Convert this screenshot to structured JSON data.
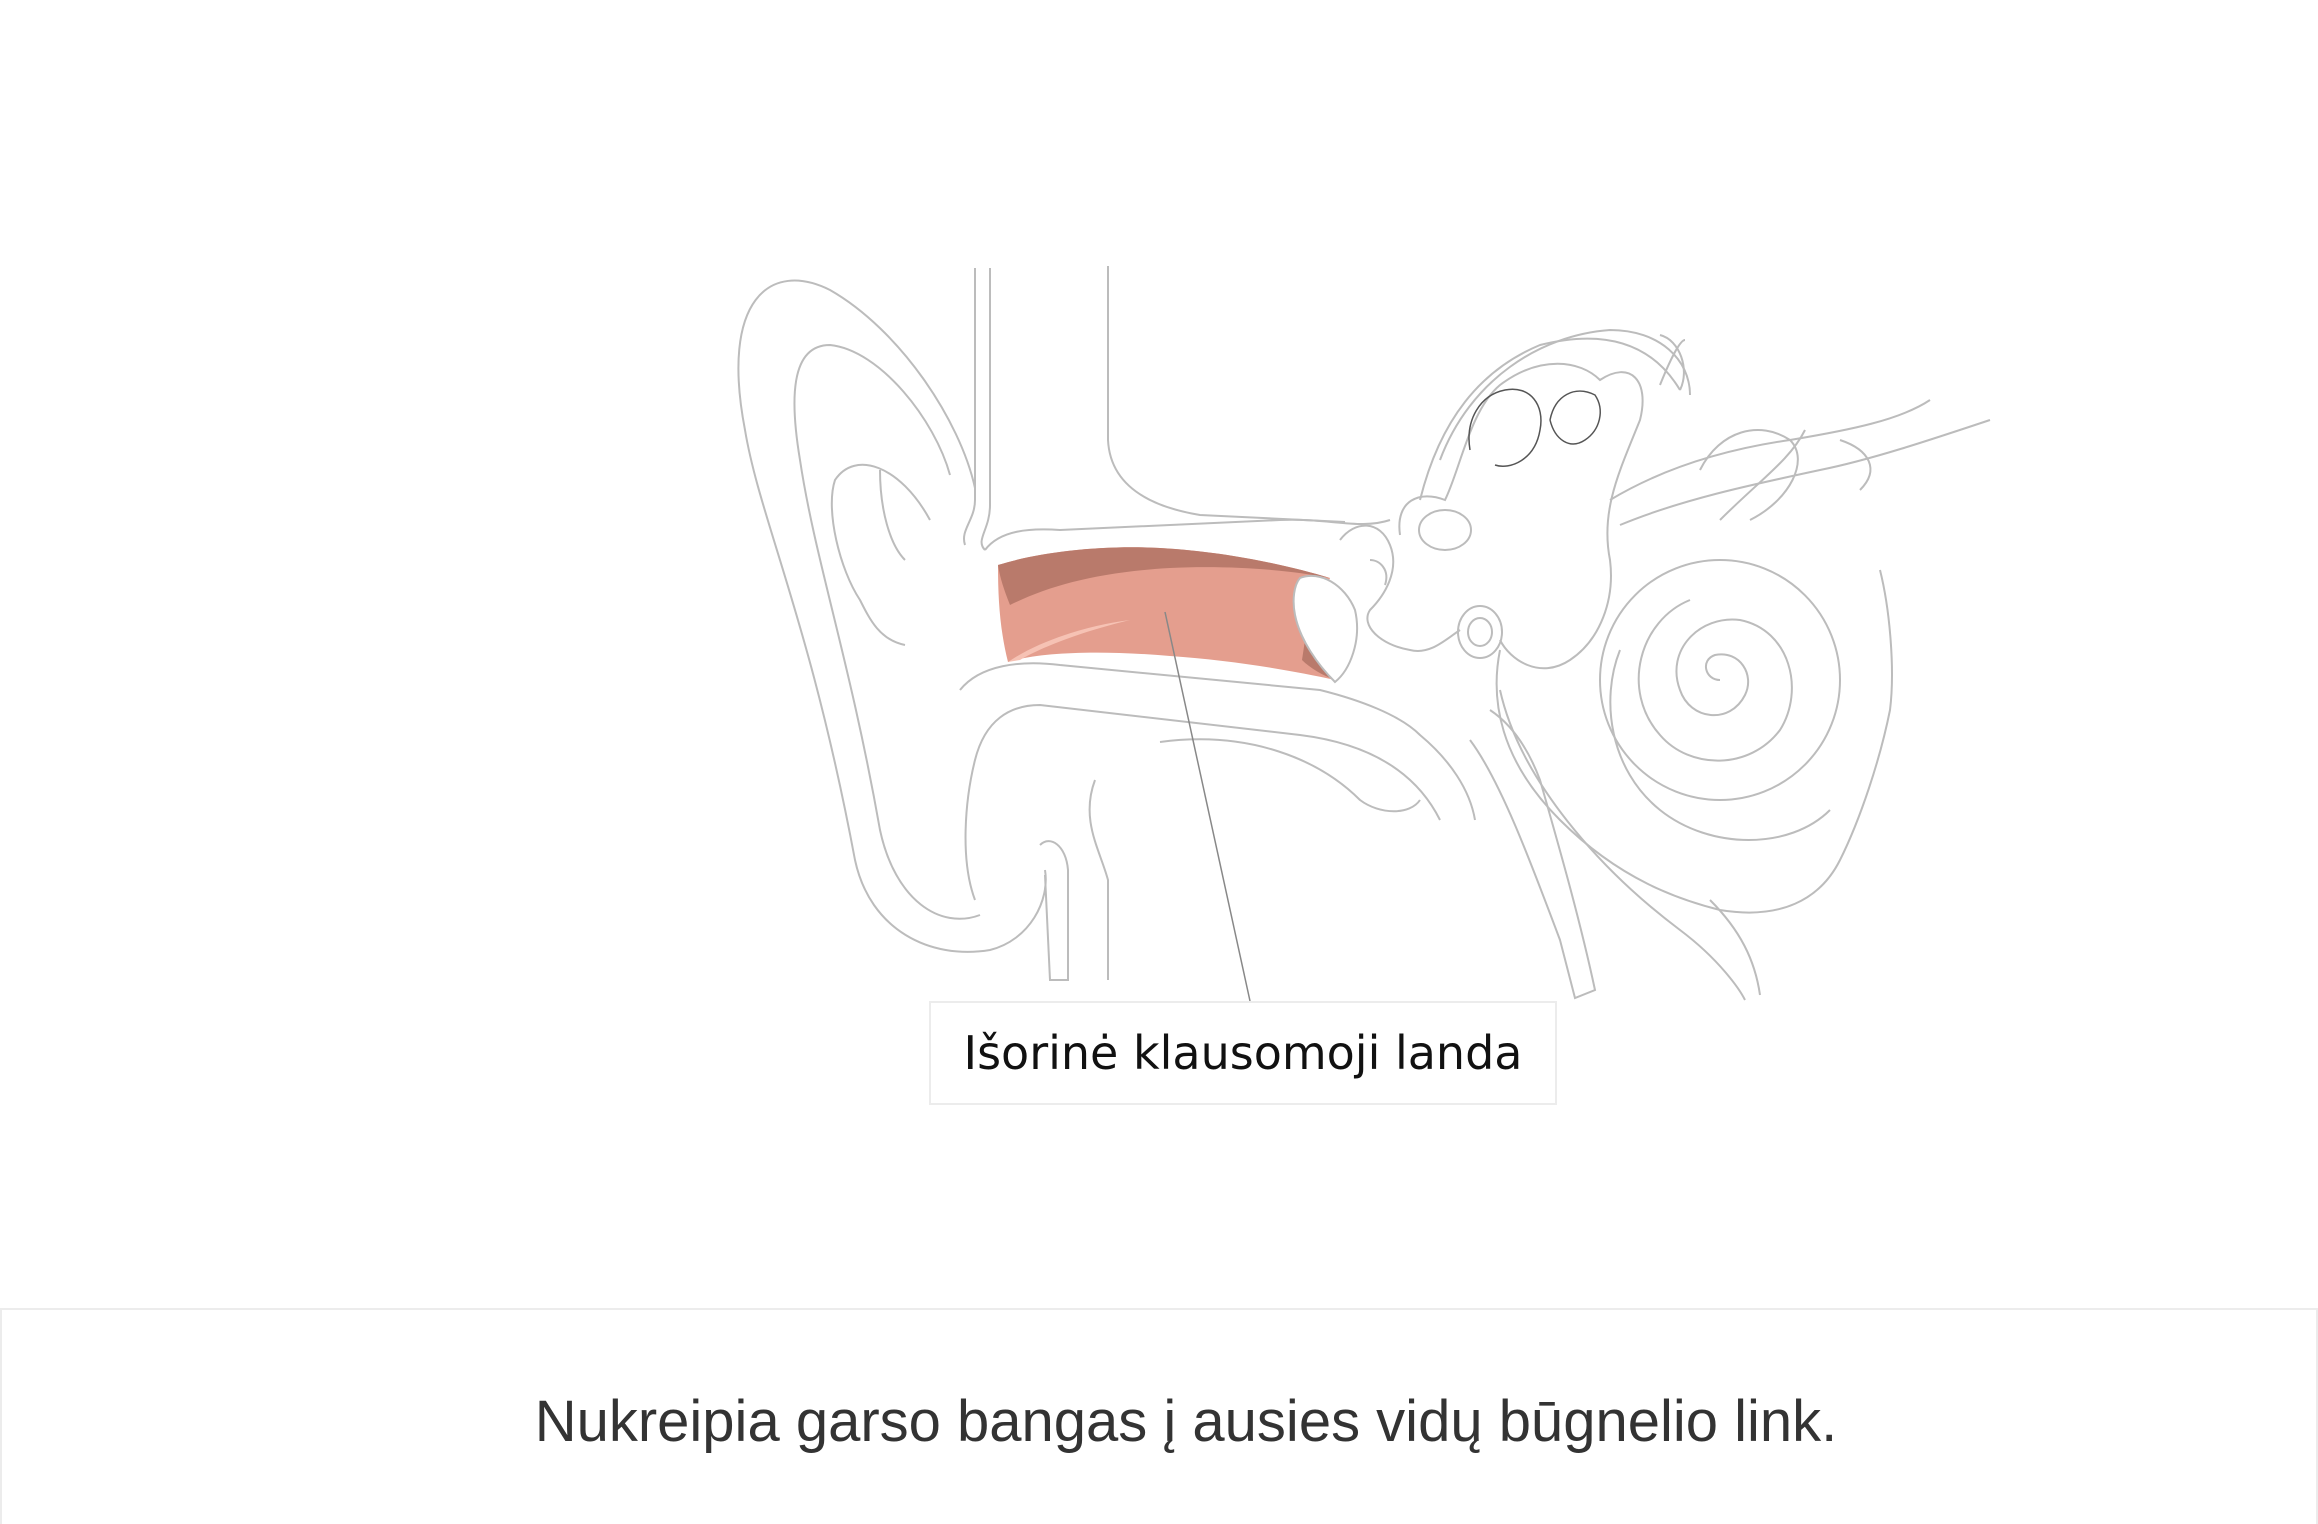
{
  "diagram": {
    "label": "Išorinė klausomoji landa",
    "highlight_colors": {
      "canal_main": "#e49e8e",
      "canal_shadow": "#b97a6b",
      "canal_light": "#f6c2b4"
    }
  },
  "caption": {
    "text": "Nukreipia garso bangas į ausies vidų būgnelio link."
  }
}
